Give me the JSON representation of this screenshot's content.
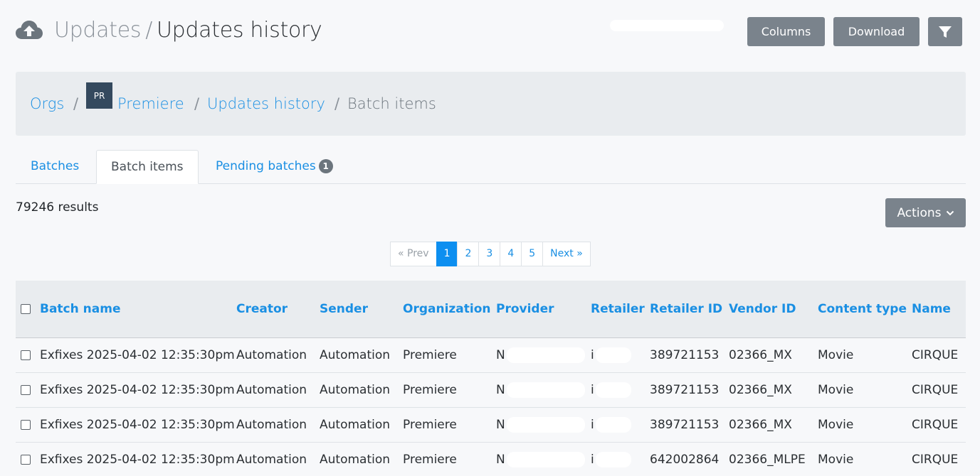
{
  "header": {
    "title_parent": "Updates",
    "title_separator": "/",
    "title_current": "Updates history",
    "icon": "cloud-upload-icon",
    "buttons": {
      "columns": "Columns",
      "download": "Download",
      "filter_icon": "filter-icon"
    }
  },
  "breadcrumb": {
    "items": [
      "Orgs",
      "Premiere",
      "Updates history",
      "Batch items"
    ],
    "separator": "/",
    "avatar_initials": "PR"
  },
  "tabs": [
    {
      "label": "Batches"
    },
    {
      "label": "Batch items",
      "active": true
    },
    {
      "label": "Pending batches",
      "badge": "1"
    }
  ],
  "results": "79246 results",
  "actions": {
    "label": "Actions",
    "icon": "chevron-down-icon"
  },
  "pagination": {
    "prev": "« Prev",
    "pages": [
      "1",
      "2",
      "3",
      "4",
      "5"
    ],
    "active": "1",
    "next": "Next »"
  },
  "table": {
    "columns": [
      "Batch name",
      "Creator",
      "Sender",
      "Organization",
      "Provider",
      "Retailer",
      "Retailer ID",
      "Vendor ID",
      "Content type",
      "Name"
    ],
    "rows": [
      [
        "Exfixes 2025-04-02 12:35:30pm",
        "Automation",
        "Automation",
        "Premiere",
        "N",
        "i",
        "389721153",
        "02366_MX",
        "Movie",
        "CIRQUE"
      ],
      [
        "Exfixes 2025-04-02 12:35:30pm",
        "Automation",
        "Automation",
        "Premiere",
        "N",
        "i",
        "389721153",
        "02366_MX",
        "Movie",
        "CIRQUE"
      ],
      [
        "Exfixes 2025-04-02 12:35:30pm",
        "Automation",
        "Automation",
        "Premiere",
        "N",
        "i",
        "389721153",
        "02366_MX",
        "Movie",
        "CIRQUE"
      ],
      [
        "Exfixes 2025-04-02 12:35:30pm",
        "Automation",
        "Automation",
        "Premiere",
        "N",
        "i",
        "642002864",
        "02366_MLPE",
        "Movie",
        "CIRQUE"
      ]
    ]
  },
  "colors": {
    "link": "#1a8fe3",
    "button_gray": "#7a838c",
    "active_page": "#0d8ff0",
    "avatar_bg": "#34495e"
  }
}
